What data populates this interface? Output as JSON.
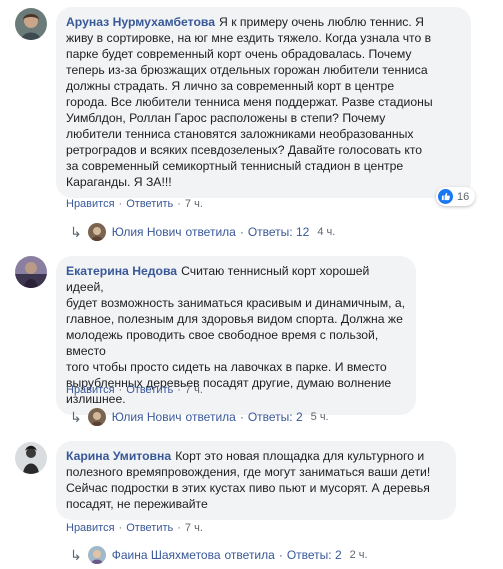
{
  "comments": [
    {
      "author": "Аруназ Нурмухамбетова",
      "text_lines": [
        "Я к примеру очень люблю теннис. Я",
        "живу в сортировке, на юг мне ездить тяжело. Когда узнала что в",
        "парке будет современный корт очень обрадовалась. Почему",
        "теперь из-за брюзжащих отдельных горожан любители тенниса",
        "должны страдать. Я лично за современный корт в центре",
        "города. Все любители тенниса меня поддержат. Разве стадионы",
        "Уимблдон, Роллан Гарос расположены в степи? Почему",
        "любители тенниса становятся заложниками необразованных",
        "ретроградов и всяких псевдозеленых? Давайте голосовать кто",
        "за современный семикортный теннисный стадион в центре",
        "Караганды. Я ЗА!!!"
      ],
      "like_label": "Нравится",
      "reply_label": "Ответить",
      "time": "7 ч.",
      "reactions_count": "16",
      "replies": {
        "author": "Юлия Нович",
        "verb": "ответила",
        "count_label": "Ответы: 12",
        "time": "4 ч."
      }
    },
    {
      "author": "Екатерина Недова",
      "text_lines": [
        "Считаю теннисный корт хорошей идеей,",
        "будет возможность заниматься красивым и динамичным, а,",
        "главное, полезным для здоровья видом спорта. Должна же",
        "молодежь проводить свое свободное время с пользой, вместо",
        "того чтобы просто сидеть на лавочках в парке. И вместо",
        "вырубленных деревьев посадят другие, думаю волнение",
        "излишнее."
      ],
      "like_label": "Нравится",
      "reply_label": "Ответить",
      "time": "7 ч.",
      "replies": {
        "author": "Юлия Нович",
        "verb": "ответила",
        "count_label": "Ответы: 2",
        "time": "5 ч."
      }
    },
    {
      "author": "Карина Умитовна",
      "text_lines": [
        "Корт это новая площадка для культурного и",
        "полезного времяпровождения, где могут заниматься ваши дети!",
        "Сейчас подростки в этих кустах пиво пьют и мусорят. А деревья",
        "посадят, не переживайте"
      ],
      "like_label": "Нравится",
      "reply_label": "Ответить",
      "time": "7 ч.",
      "replies": {
        "author": "Фаина Шаяхметова",
        "verb": "ответила",
        "count_label": "Ответы: 2",
        "time": "2 ч."
      }
    }
  ],
  "icons": {
    "like": "thumbs-up-icon",
    "reply_arrow": "reply-arrow-icon"
  },
  "colors": {
    "link": "#385898",
    "bubble": "#f2f3f5",
    "meta": "#606770",
    "like_blue": "#1877f2"
  }
}
